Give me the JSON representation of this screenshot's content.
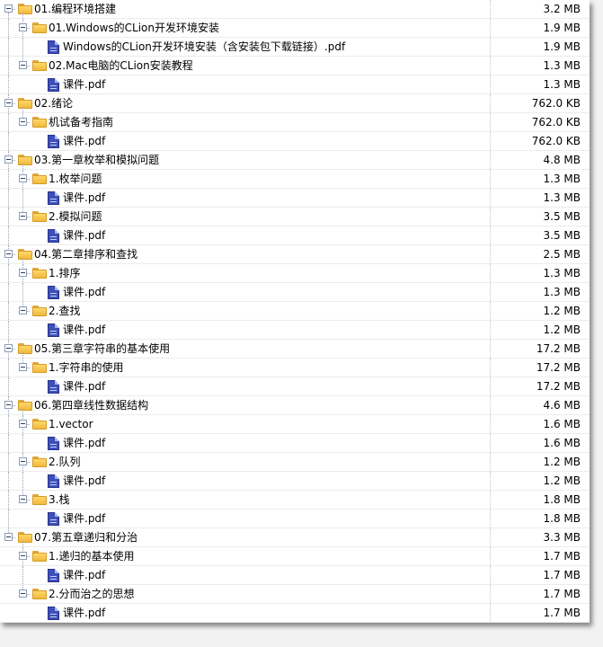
{
  "tree": [
    {
      "name": "01.编程环境搭建",
      "size": "3.2 MB",
      "children": [
        {
          "name": "01.Windows的CLion开发环境安装",
          "size": "1.9 MB",
          "children": [
            {
              "name": "Windows的CLion开发环境安装（含安装包下载链接）.pdf",
              "size": "1.9 MB"
            }
          ]
        },
        {
          "name": "02.Mac电脑的CLion安装教程",
          "size": "1.3 MB",
          "children": [
            {
              "name": "课件.pdf",
              "size": "1.3 MB"
            }
          ]
        }
      ]
    },
    {
      "name": "02.绪论",
      "size": "762.0 KB",
      "children": [
        {
          "name": "机试备考指南",
          "size": "762.0 KB",
          "children": [
            {
              "name": "课件.pdf",
              "size": "762.0 KB"
            }
          ]
        }
      ]
    },
    {
      "name": "03.第一章枚举和模拟问题",
      "size": "4.8 MB",
      "children": [
        {
          "name": "1.枚举问题",
          "size": "1.3 MB",
          "children": [
            {
              "name": "课件.pdf",
              "size": "1.3 MB"
            }
          ]
        },
        {
          "name": "2.模拟问题",
          "size": "3.5 MB",
          "children": [
            {
              "name": "课件.pdf",
              "size": "3.5 MB"
            }
          ]
        }
      ]
    },
    {
      "name": "04.第二章排序和查找",
      "size": "2.5 MB",
      "children": [
        {
          "name": "1.排序",
          "size": "1.3 MB",
          "children": [
            {
              "name": "课件.pdf",
              "size": "1.3 MB"
            }
          ]
        },
        {
          "name": "2.查找",
          "size": "1.2 MB",
          "children": [
            {
              "name": "课件.pdf",
              "size": "1.2 MB"
            }
          ]
        }
      ]
    },
    {
      "name": "05.第三章字符串的基本使用",
      "size": "17.2 MB",
      "children": [
        {
          "name": "1.字符串的使用",
          "size": "17.2 MB",
          "children": [
            {
              "name": "课件.pdf",
              "size": "17.2 MB"
            }
          ]
        }
      ]
    },
    {
      "name": "06.第四章线性数据结构",
      "size": "4.6 MB",
      "children": [
        {
          "name": "1.vector",
          "size": "1.6 MB",
          "children": [
            {
              "name": "课件.pdf",
              "size": "1.6 MB"
            }
          ]
        },
        {
          "name": "2.队列",
          "size": "1.2 MB",
          "children": [
            {
              "name": "课件.pdf",
              "size": "1.2 MB"
            }
          ]
        },
        {
          "name": "3.栈",
          "size": "1.8 MB",
          "children": [
            {
              "name": "课件.pdf",
              "size": "1.8 MB"
            }
          ]
        }
      ]
    },
    {
      "name": "07.第五章递归和分治",
      "size": "3.3 MB",
      "children": [
        {
          "name": "1.递归的基本使用",
          "size": "1.7 MB",
          "children": [
            {
              "name": "课件.pdf",
              "size": "1.7 MB"
            }
          ]
        },
        {
          "name": "2.分而治之的思想",
          "size": "1.7 MB",
          "children": [
            {
              "name": "课件.pdf",
              "size": "1.7 MB"
            }
          ]
        }
      ]
    }
  ]
}
